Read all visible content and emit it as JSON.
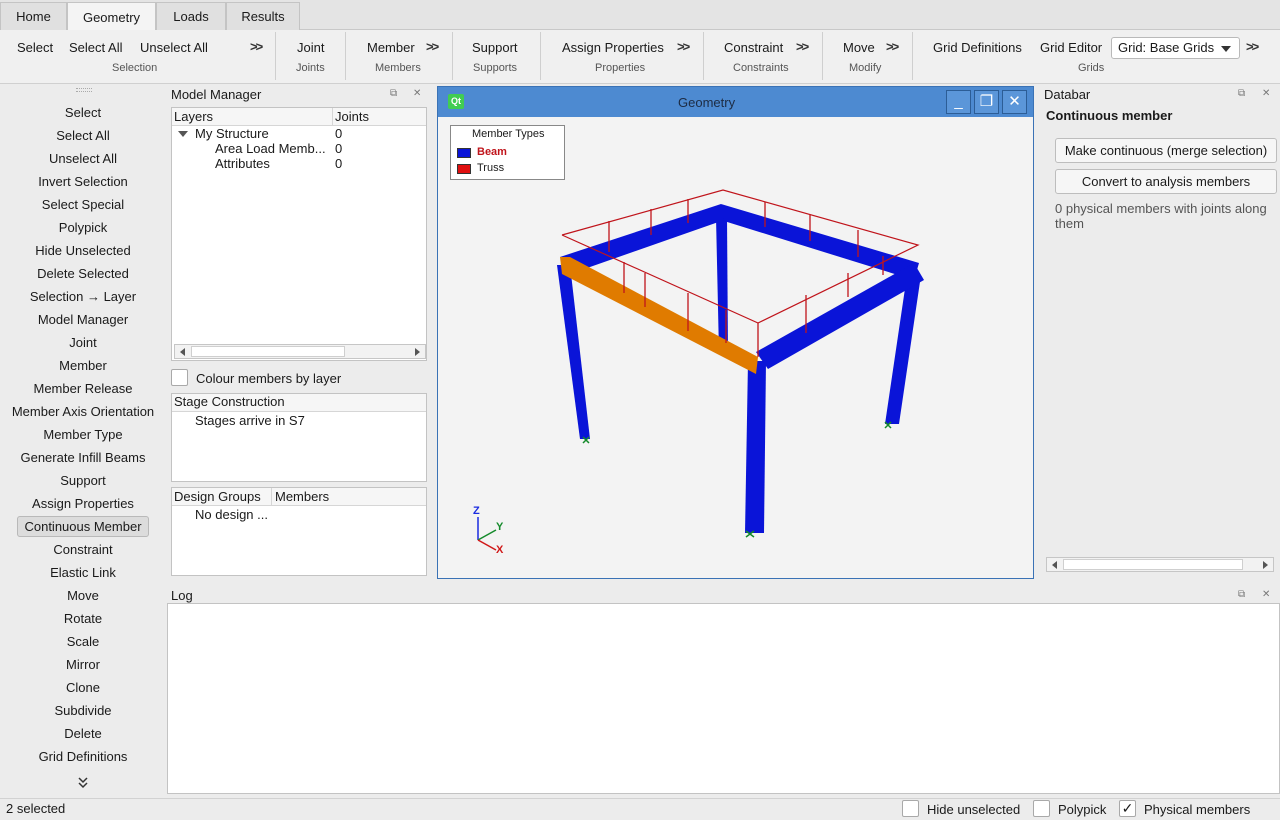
{
  "tabs": [
    "Home",
    "Geometry",
    "Loads",
    "Results"
  ],
  "ribbon": {
    "selection": {
      "items": [
        "Select",
        "Select All",
        "Unselect All"
      ],
      "group": "Selection"
    },
    "joints": {
      "items": [
        "Joint"
      ],
      "group": "Joints"
    },
    "members": {
      "items": [
        "Member"
      ],
      "group": "Members"
    },
    "supports": {
      "items": [
        "Support"
      ],
      "group": "Supports"
    },
    "properties": {
      "items": [
        "Assign Properties"
      ],
      "group": "Properties"
    },
    "constraints": {
      "items": [
        "Constraint"
      ],
      "group": "Constraints"
    },
    "modify": {
      "items": [
        "Move"
      ],
      "group": "Modify"
    },
    "grids": {
      "items": [
        "Grid Definitions",
        "Grid Editor"
      ],
      "group": "Grids",
      "select_value": "Grid: Base Grids"
    },
    "more_icon": ">>"
  },
  "tools": [
    "Select",
    "Select All",
    "Unselect All",
    "Invert Selection",
    "Select Special",
    "Polypick",
    "Hide Unselected",
    "Delete Selected",
    "Selection → Layer",
    "Model Manager",
    "Joint",
    "Member",
    "Member Release",
    "Member Axis Orientation",
    "Member Type",
    "Generate Infill Beams",
    "Support",
    "Assign Properties",
    "Continuous Member",
    "Constraint",
    "Elastic Link",
    "Move",
    "Rotate",
    "Scale",
    "Mirror",
    "Clone",
    "Subdivide",
    "Delete",
    "Grid Definitions"
  ],
  "active_tool": "Continuous Member",
  "model_manager": {
    "title": "Model Manager",
    "columns": [
      "Layers",
      "Joints"
    ],
    "rows": [
      {
        "name": "My Structure",
        "joints": "0"
      },
      {
        "name": "Area Load Memb...",
        "joints": "0"
      },
      {
        "name": "Attributes",
        "joints": "0"
      }
    ],
    "colour_by_layer": "Colour members by layer",
    "stage_title": "Stage Construction",
    "stage_text": "Stages arrive in S7",
    "design_columns": [
      "Design Groups",
      "Members"
    ],
    "design_text": "No design ..."
  },
  "geometry": {
    "title": "Geometry",
    "app_badge": "Qt",
    "legend_title": "Member Types",
    "legend": [
      {
        "label": "Beam",
        "color": "#0a14d8"
      },
      {
        "label": "Truss",
        "color": "#e01010"
      }
    ],
    "axes": {
      "z": "Z",
      "y": "Y",
      "x": "X"
    }
  },
  "databar": {
    "title": "Databar",
    "heading": "Continuous member",
    "merge_button": "Make continuous (merge selection)",
    "convert_button": "Convert to analysis members",
    "info": "0 physical members with joints along them"
  },
  "log": {
    "title": "Log"
  },
  "status": {
    "selected": "2 selected",
    "hide_unselected": "Hide unselected",
    "polypick": "Polypick",
    "physical_members": "Physical members",
    "physical_checked": "✓"
  },
  "colors": {
    "beam": "#0a14d8",
    "selected_member": "#e07b00",
    "load": "#c0141b",
    "title_bar": "#4d8ad1"
  }
}
